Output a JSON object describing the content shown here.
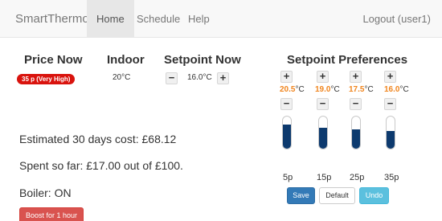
{
  "navbar": {
    "brand": "SmartThermo",
    "items": [
      "Home",
      "Schedule",
      "Help"
    ],
    "logout": "Logout (user1)"
  },
  "price": {
    "heading": "Price Now",
    "badge": "35 p (Very High)"
  },
  "indoor": {
    "heading": "Indoor",
    "value": "20°C"
  },
  "setpoint": {
    "heading": "Setpoint Now",
    "minus": "−",
    "plus": "+",
    "value": "16.0°C"
  },
  "info": {
    "estimated": "Estimated 30 days cost: £68.12",
    "spent": "Spent so far: £17.00 out of £100.",
    "boiler": "Boiler: ON",
    "boost_label": "Boost for 1 hour"
  },
  "preferences": {
    "heading": "Setpoint Preferences",
    "plus": "+",
    "minus": "−",
    "unit": "°C",
    "items": [
      {
        "value": "20.5",
        "label": "5p",
        "level": 0.75
      },
      {
        "value": "19.0",
        "label": "15p",
        "level": 0.66
      },
      {
        "value": "17.5",
        "label": "25p",
        "level": 0.6
      },
      {
        "value": "16.0",
        "label": "35p",
        "level": 0.55
      }
    ],
    "bar_color": "#0d3a6e",
    "value_color": "#f0851e"
  },
  "actions": {
    "save": "Save",
    "default": "Default",
    "undo": "Undo"
  }
}
